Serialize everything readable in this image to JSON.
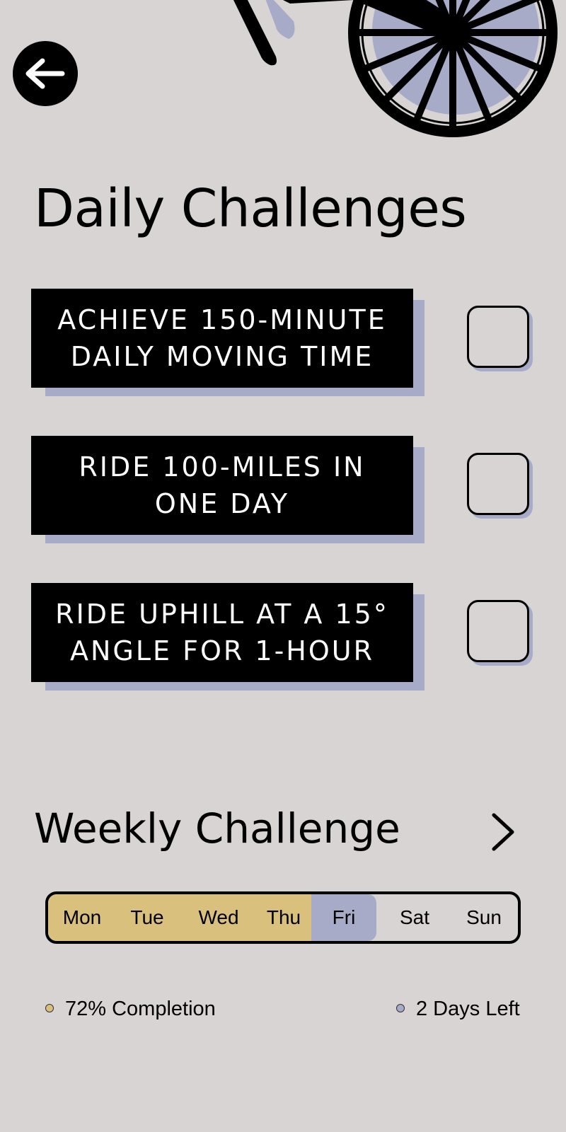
{
  "nav": {
    "back_icon": "arrow-left-icon"
  },
  "hero": {
    "illustration": "bicycle-wheel-illustration"
  },
  "daily": {
    "title": "Daily Challenges",
    "challenges": [
      {
        "label": "ACHIEVE 150-MINUTE\nDAILY MOVING TIME",
        "checked": false
      },
      {
        "label": "RIDE 100-MILES IN\nONE DAY",
        "checked": false
      },
      {
        "label": "RIDE UPHILL AT A 15°\nANGLE FOR 1-HOUR",
        "checked": false
      }
    ]
  },
  "weekly": {
    "title": "Weekly Challenge",
    "chevron_icon": "chevron-right-icon",
    "days": [
      {
        "label": "Mon",
        "state": "completed"
      },
      {
        "label": "Tue",
        "state": "completed"
      },
      {
        "label": "Wed",
        "state": "completed"
      },
      {
        "label": "Thu",
        "state": "completed"
      },
      {
        "label": "Fri",
        "state": "today"
      },
      {
        "label": "Sat",
        "state": "remaining"
      },
      {
        "label": "Sun",
        "state": "remaining"
      }
    ],
    "completion_label": "72% Completion",
    "completion_fraction": 0.72,
    "days_left_label": "2 Days Left"
  },
  "colors": {
    "background": "#d7d4d3",
    "accent_gold": "#d9c07c",
    "accent_lavender": "#a8abc8",
    "card": "#000000",
    "card_text": "#ffffff"
  }
}
